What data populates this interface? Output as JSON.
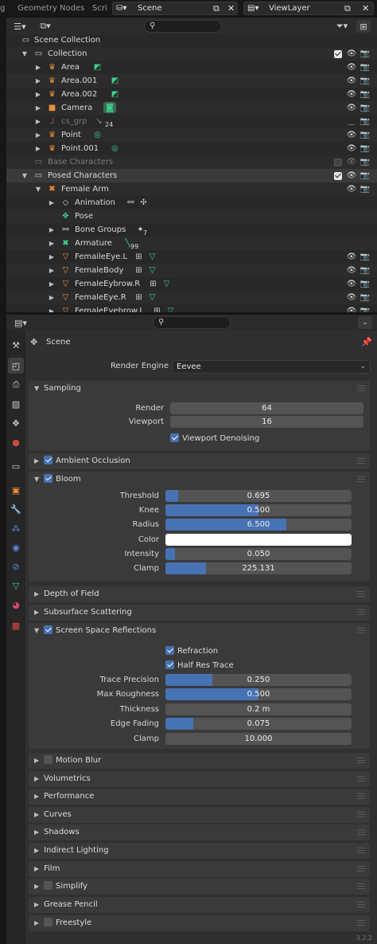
{
  "topbar": {
    "tab_partial": "g",
    "tab_geometry": "Geometry Nodes",
    "tab_script": "Scri",
    "scene_name": "Scene",
    "view_layer": "ViewLayer"
  },
  "outliner": {
    "rows": [
      {
        "label": "Scene Collection",
        "icon": "scene-collection-icon"
      },
      {
        "label": "Collection",
        "icon": "collection-icon"
      },
      {
        "label": "Area",
        "icon": "light-icon"
      },
      {
        "label": "Area.001",
        "icon": "light-icon"
      },
      {
        "label": "Area.002",
        "icon": "light-icon"
      },
      {
        "label": "Camera",
        "icon": "camera-icon"
      },
      {
        "label": "cs_grp",
        "icon": "empty-icon",
        "badge": "24"
      },
      {
        "label": "Point",
        "icon": "light-icon"
      },
      {
        "label": "Point.001",
        "icon": "light-icon"
      },
      {
        "label": "Base Characters",
        "icon": "collection-icon"
      },
      {
        "label": "Posed Characters",
        "icon": "collection-icon"
      },
      {
        "label": "Female Arm",
        "icon": "armature-icon"
      },
      {
        "label": "Animation",
        "icon": "animation-icon"
      },
      {
        "label": "Pose",
        "icon": "pose-icon"
      },
      {
        "label": "Bone Groups",
        "icon": "bone-groups-icon",
        "badge": "7"
      },
      {
        "label": "Armature",
        "icon": "armature-data-icon",
        "badge": "99"
      },
      {
        "label": "FemaileEye.L",
        "icon": "mesh-icon"
      },
      {
        "label": "FemaleBody",
        "icon": "mesh-icon"
      },
      {
        "label": "FemaleEybrow.R",
        "icon": "mesh-icon"
      },
      {
        "label": "FemaleEye.R",
        "icon": "mesh-icon"
      },
      {
        "label": "FemaleEyebrow.L",
        "icon": "mesh-icon"
      }
    ]
  },
  "properties": {
    "context_title": "Scene",
    "render_engine_label": "Render Engine",
    "render_engine_value": "Eevee",
    "sampling": {
      "title": "Sampling",
      "render_label": "Render",
      "render_value": "64",
      "viewport_label": "Viewport",
      "viewport_value": "16",
      "denoise_label": "Viewport Denoising"
    },
    "ambient_occlusion": "Ambient Occlusion",
    "bloom": {
      "title": "Bloom",
      "threshold_label": "Threshold",
      "threshold_value": "0.695",
      "threshold_fill": 0.07,
      "knee_label": "Knee",
      "knee_value": "0.500",
      "knee_fill": 0.5,
      "radius_label": "Radius",
      "radius_value": "6.500",
      "radius_fill": 0.65,
      "color_label": "Color",
      "intensity_label": "Intensity",
      "intensity_value": "0.050",
      "intensity_fill": 0.05,
      "clamp_label": "Clamp",
      "clamp_value": "225.131",
      "clamp_fill": 0.22
    },
    "depth_of_field": "Depth of Field",
    "subsurface": "Subsurface Scattering",
    "ssr": {
      "title": "Screen Space Reflections",
      "refraction_label": "Refraction",
      "halfres_label": "Half Res Trace",
      "trace_precision_label": "Trace Precision",
      "trace_precision_value": "0.250",
      "trace_precision_fill": 0.25,
      "max_roughness_label": "Max Roughness",
      "max_roughness_value": "0.500",
      "max_roughness_fill": 0.5,
      "thickness_label": "Thickness",
      "thickness_value": "0.2 m",
      "edge_fading_label": "Edge Fading",
      "edge_fading_value": "0.075",
      "edge_fading_fill": 0.15,
      "clamp_label": "Clamp",
      "clamp_value": "10.000"
    },
    "collapsed_panels": [
      {
        "label": "Motion Blur",
        "checkbox": true
      },
      {
        "label": "Volumetrics",
        "checkbox": false
      },
      {
        "label": "Performance",
        "checkbox": false
      },
      {
        "label": "Curves",
        "checkbox": false
      },
      {
        "label": "Shadows",
        "checkbox": false
      },
      {
        "label": "Indirect Lighting",
        "checkbox": false
      },
      {
        "label": "Film",
        "checkbox": false
      },
      {
        "label": "Simplify",
        "checkbox": true
      },
      {
        "label": "Grease Pencil",
        "checkbox": false
      },
      {
        "label": "Freestyle",
        "checkbox": true
      }
    ],
    "version": "3.2.2"
  },
  "colors": {
    "accent": "#4772b3",
    "light_icon": "#e8913a",
    "object_icon": "#f08a3c",
    "data_icon": "#3fd18e",
    "bone_icon": "#b0c0d0"
  }
}
